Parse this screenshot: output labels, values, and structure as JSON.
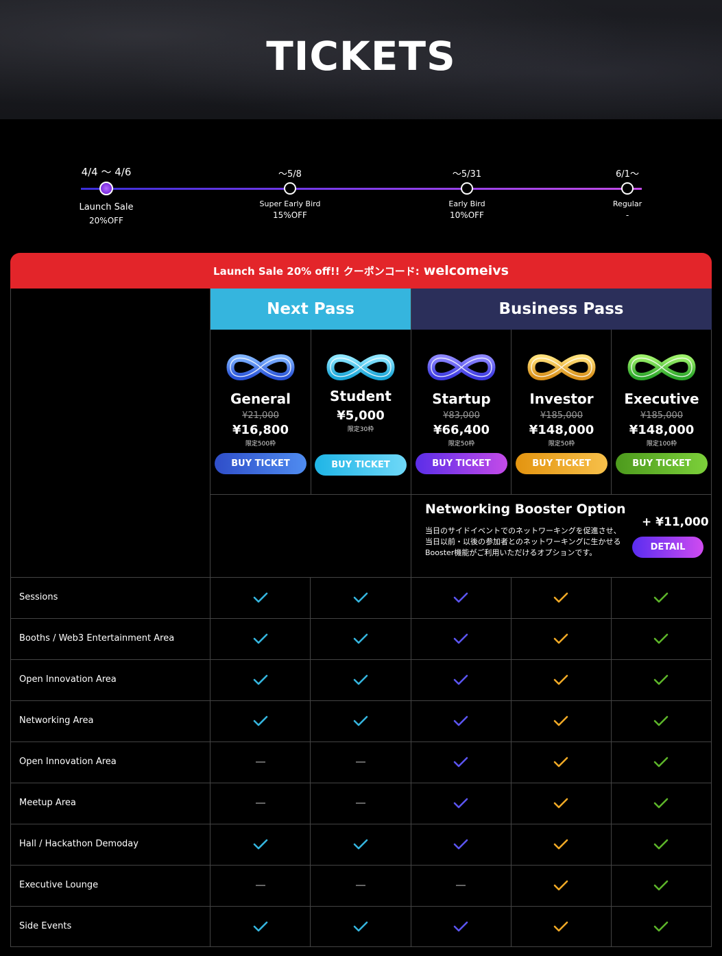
{
  "page": {
    "title": "TICKETS"
  },
  "timeline": [
    {
      "date": "4/4 〜 4/6",
      "name": "Launch Sale",
      "discount": "20%OFF",
      "active": true
    },
    {
      "date": "〜5/8",
      "name": "Super Early Bird",
      "discount": "15%OFF",
      "active": false
    },
    {
      "date": "〜5/31",
      "name": "Early Bird",
      "discount": "10%OFF",
      "active": false
    },
    {
      "date": "6/1〜",
      "name": "Regular",
      "discount": "-",
      "active": false
    }
  ],
  "banner": {
    "text": "Launch Sale 20% off!! クーポンコード:",
    "code": "welcomeivs"
  },
  "passes": {
    "next": "Next Pass",
    "business": "Business Pass"
  },
  "tickets": [
    {
      "name": "General",
      "old_price": "¥21,000",
      "price": "¥16,800",
      "limit": "限定500枠",
      "button": "BUY TICKET",
      "color": "#3b7be6",
      "logo": "blue"
    },
    {
      "name": "Student",
      "old_price": "",
      "price": "¥5,000",
      "limit": "限定30枠",
      "button": "BUY TICKET",
      "color": "#34c0ee",
      "logo": "cyan"
    },
    {
      "name": "Startup",
      "old_price": "¥83,000",
      "price": "¥66,400",
      "limit": "限定50枠",
      "button": "BUY TICKET",
      "color": "#7a4bf0",
      "logo": "indigo"
    },
    {
      "name": "Investor",
      "old_price": "¥185,000",
      "price": "¥148,000",
      "limit": "限定50枠",
      "button": "BUY TICKET",
      "color": "#f0a926",
      "logo": "gold"
    },
    {
      "name": "Executive",
      "old_price": "¥185,000",
      "price": "¥148,000",
      "limit": "限定100枠",
      "button": "BUY TICKET",
      "color": "#5db52a",
      "logo": "green"
    }
  ],
  "booster": {
    "title": "Networking Booster Option",
    "description": "当日のサイドイベントでのネットワーキングを促進させ、当日以前・以後の参加者とのネットワーキングに生かせるBooster機能がご利用いただけるオプションです。",
    "price": "+ ¥11,000",
    "button": "DETAIL"
  },
  "features": [
    {
      "label": "Sessions",
      "values": [
        true,
        true,
        true,
        true,
        true
      ]
    },
    {
      "label": "Booths / Web3 Entertainment Area",
      "values": [
        true,
        true,
        true,
        true,
        true
      ]
    },
    {
      "label": "Open Innovation Area",
      "values": [
        true,
        true,
        true,
        true,
        true
      ]
    },
    {
      "label": "Networking Area",
      "values": [
        true,
        true,
        true,
        true,
        true
      ]
    },
    {
      "label": "Open Innovation Area",
      "values": [
        false,
        false,
        true,
        true,
        true
      ]
    },
    {
      "label": "Meetup Area",
      "values": [
        false,
        false,
        true,
        true,
        true
      ]
    },
    {
      "label": "Hall / Hackathon Demoday",
      "values": [
        true,
        true,
        true,
        true,
        true
      ]
    },
    {
      "label": "Executive Lounge",
      "values": [
        false,
        false,
        false,
        true,
        true
      ]
    },
    {
      "label": "Side Events",
      "values": [
        true,
        true,
        true,
        true,
        true
      ]
    }
  ],
  "check_colors": [
    "#35b5de",
    "#35b5de",
    "#5b55f0",
    "#f0a926",
    "#5db52a"
  ]
}
